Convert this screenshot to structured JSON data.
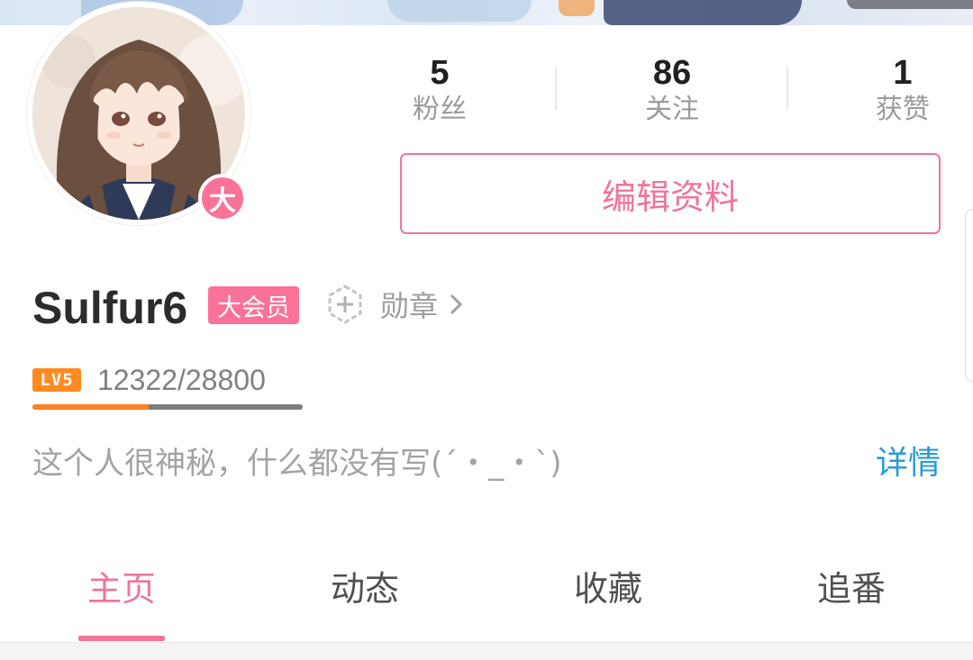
{
  "profile": {
    "username": "Sulfur6",
    "vip_tag": "大会员",
    "avatar_badge": "大",
    "stats": [
      {
        "value": "5",
        "label": "粉丝"
      },
      {
        "value": "86",
        "label": "关注"
      },
      {
        "value": "1",
        "label": "获赞"
      }
    ],
    "edit_button": "编辑资料",
    "medal_label": "勋章",
    "level": {
      "badge": "LV5",
      "exp_text": "12322/28800",
      "progress": 0.43
    },
    "bio": "这个人很神秘，什么都没有写(´・_・`)",
    "detail_link": "详情"
  },
  "tabs": [
    {
      "label": "主页",
      "active": true
    },
    {
      "label": "动态",
      "active": false
    },
    {
      "label": "收藏",
      "active": false
    },
    {
      "label": "追番",
      "active": false
    }
  ],
  "colors": {
    "accent_pink": "#f0749a",
    "vip_pink": "#fb7299",
    "level_orange": "#ff8a1f",
    "link_blue": "#2a9bd6"
  },
  "icons": {
    "medal": "medal-icon",
    "chevron": "chevron-right-icon"
  }
}
